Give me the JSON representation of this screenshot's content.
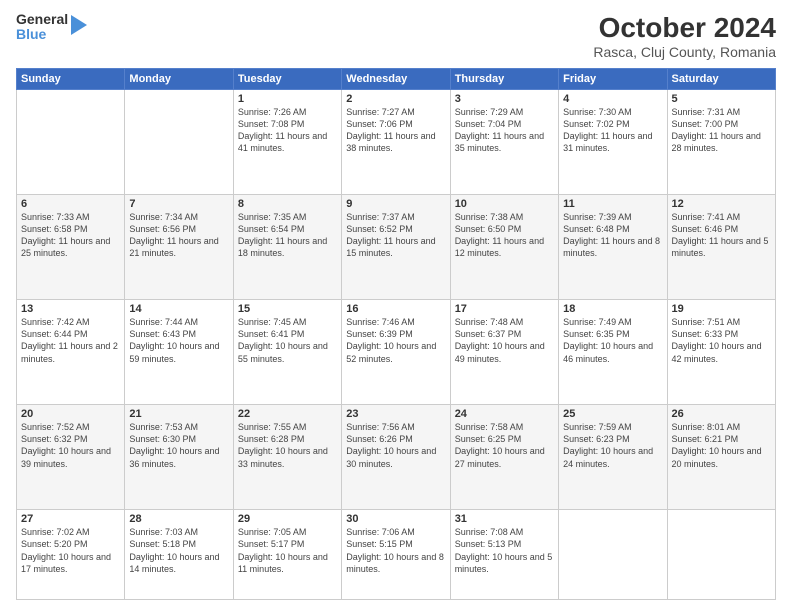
{
  "header": {
    "logo_line1": "General",
    "logo_line2": "Blue",
    "title": "October 2024",
    "subtitle": "Rasca, Cluj County, Romania"
  },
  "weekdays": [
    "Sunday",
    "Monday",
    "Tuesday",
    "Wednesday",
    "Thursday",
    "Friday",
    "Saturday"
  ],
  "weeks": [
    [
      {
        "day": "",
        "sunrise": "",
        "sunset": "",
        "daylight": ""
      },
      {
        "day": "",
        "sunrise": "",
        "sunset": "",
        "daylight": ""
      },
      {
        "day": "1",
        "sunrise": "Sunrise: 7:26 AM",
        "sunset": "Sunset: 7:08 PM",
        "daylight": "Daylight: 11 hours and 41 minutes."
      },
      {
        "day": "2",
        "sunrise": "Sunrise: 7:27 AM",
        "sunset": "Sunset: 7:06 PM",
        "daylight": "Daylight: 11 hours and 38 minutes."
      },
      {
        "day": "3",
        "sunrise": "Sunrise: 7:29 AM",
        "sunset": "Sunset: 7:04 PM",
        "daylight": "Daylight: 11 hours and 35 minutes."
      },
      {
        "day": "4",
        "sunrise": "Sunrise: 7:30 AM",
        "sunset": "Sunset: 7:02 PM",
        "daylight": "Daylight: 11 hours and 31 minutes."
      },
      {
        "day": "5",
        "sunrise": "Sunrise: 7:31 AM",
        "sunset": "Sunset: 7:00 PM",
        "daylight": "Daylight: 11 hours and 28 minutes."
      }
    ],
    [
      {
        "day": "6",
        "sunrise": "Sunrise: 7:33 AM",
        "sunset": "Sunset: 6:58 PM",
        "daylight": "Daylight: 11 hours and 25 minutes."
      },
      {
        "day": "7",
        "sunrise": "Sunrise: 7:34 AM",
        "sunset": "Sunset: 6:56 PM",
        "daylight": "Daylight: 11 hours and 21 minutes."
      },
      {
        "day": "8",
        "sunrise": "Sunrise: 7:35 AM",
        "sunset": "Sunset: 6:54 PM",
        "daylight": "Daylight: 11 hours and 18 minutes."
      },
      {
        "day": "9",
        "sunrise": "Sunrise: 7:37 AM",
        "sunset": "Sunset: 6:52 PM",
        "daylight": "Daylight: 11 hours and 15 minutes."
      },
      {
        "day": "10",
        "sunrise": "Sunrise: 7:38 AM",
        "sunset": "Sunset: 6:50 PM",
        "daylight": "Daylight: 11 hours and 12 minutes."
      },
      {
        "day": "11",
        "sunrise": "Sunrise: 7:39 AM",
        "sunset": "Sunset: 6:48 PM",
        "daylight": "Daylight: 11 hours and 8 minutes."
      },
      {
        "day": "12",
        "sunrise": "Sunrise: 7:41 AM",
        "sunset": "Sunset: 6:46 PM",
        "daylight": "Daylight: 11 hours and 5 minutes."
      }
    ],
    [
      {
        "day": "13",
        "sunrise": "Sunrise: 7:42 AM",
        "sunset": "Sunset: 6:44 PM",
        "daylight": "Daylight: 11 hours and 2 minutes."
      },
      {
        "day": "14",
        "sunrise": "Sunrise: 7:44 AM",
        "sunset": "Sunset: 6:43 PM",
        "daylight": "Daylight: 10 hours and 59 minutes."
      },
      {
        "day": "15",
        "sunrise": "Sunrise: 7:45 AM",
        "sunset": "Sunset: 6:41 PM",
        "daylight": "Daylight: 10 hours and 55 minutes."
      },
      {
        "day": "16",
        "sunrise": "Sunrise: 7:46 AM",
        "sunset": "Sunset: 6:39 PM",
        "daylight": "Daylight: 10 hours and 52 minutes."
      },
      {
        "day": "17",
        "sunrise": "Sunrise: 7:48 AM",
        "sunset": "Sunset: 6:37 PM",
        "daylight": "Daylight: 10 hours and 49 minutes."
      },
      {
        "day": "18",
        "sunrise": "Sunrise: 7:49 AM",
        "sunset": "Sunset: 6:35 PM",
        "daylight": "Daylight: 10 hours and 46 minutes."
      },
      {
        "day": "19",
        "sunrise": "Sunrise: 7:51 AM",
        "sunset": "Sunset: 6:33 PM",
        "daylight": "Daylight: 10 hours and 42 minutes."
      }
    ],
    [
      {
        "day": "20",
        "sunrise": "Sunrise: 7:52 AM",
        "sunset": "Sunset: 6:32 PM",
        "daylight": "Daylight: 10 hours and 39 minutes."
      },
      {
        "day": "21",
        "sunrise": "Sunrise: 7:53 AM",
        "sunset": "Sunset: 6:30 PM",
        "daylight": "Daylight: 10 hours and 36 minutes."
      },
      {
        "day": "22",
        "sunrise": "Sunrise: 7:55 AM",
        "sunset": "Sunset: 6:28 PM",
        "daylight": "Daylight: 10 hours and 33 minutes."
      },
      {
        "day": "23",
        "sunrise": "Sunrise: 7:56 AM",
        "sunset": "Sunset: 6:26 PM",
        "daylight": "Daylight: 10 hours and 30 minutes."
      },
      {
        "day": "24",
        "sunrise": "Sunrise: 7:58 AM",
        "sunset": "Sunset: 6:25 PM",
        "daylight": "Daylight: 10 hours and 27 minutes."
      },
      {
        "day": "25",
        "sunrise": "Sunrise: 7:59 AM",
        "sunset": "Sunset: 6:23 PM",
        "daylight": "Daylight: 10 hours and 24 minutes."
      },
      {
        "day": "26",
        "sunrise": "Sunrise: 8:01 AM",
        "sunset": "Sunset: 6:21 PM",
        "daylight": "Daylight: 10 hours and 20 minutes."
      }
    ],
    [
      {
        "day": "27",
        "sunrise": "Sunrise: 7:02 AM",
        "sunset": "Sunset: 5:20 PM",
        "daylight": "Daylight: 10 hours and 17 minutes."
      },
      {
        "day": "28",
        "sunrise": "Sunrise: 7:03 AM",
        "sunset": "Sunset: 5:18 PM",
        "daylight": "Daylight: 10 hours and 14 minutes."
      },
      {
        "day": "29",
        "sunrise": "Sunrise: 7:05 AM",
        "sunset": "Sunset: 5:17 PM",
        "daylight": "Daylight: 10 hours and 11 minutes."
      },
      {
        "day": "30",
        "sunrise": "Sunrise: 7:06 AM",
        "sunset": "Sunset: 5:15 PM",
        "daylight": "Daylight: 10 hours and 8 minutes."
      },
      {
        "day": "31",
        "sunrise": "Sunrise: 7:08 AM",
        "sunset": "Sunset: 5:13 PM",
        "daylight": "Daylight: 10 hours and 5 minutes."
      },
      {
        "day": "",
        "sunrise": "",
        "sunset": "",
        "daylight": ""
      },
      {
        "day": "",
        "sunrise": "",
        "sunset": "",
        "daylight": ""
      }
    ]
  ]
}
